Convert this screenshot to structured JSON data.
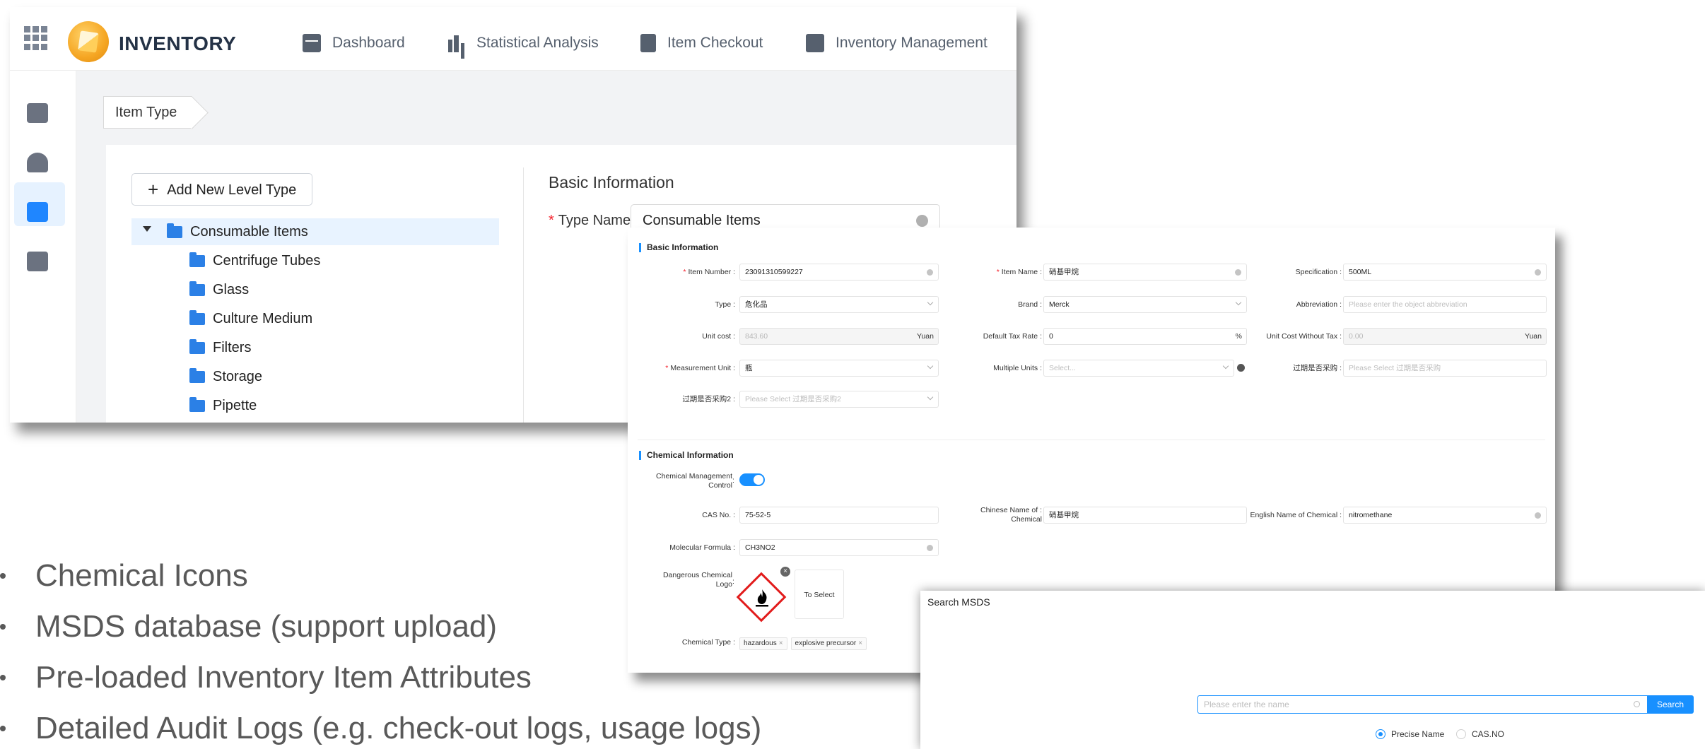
{
  "app": {
    "brand": "INVENTORY",
    "nav": [
      {
        "label": "Dashboard",
        "icon": "dashboard-icon"
      },
      {
        "label": "Statistical Analysis",
        "icon": "statistics-icon"
      },
      {
        "label": "Item Checkout",
        "icon": "checkout-icon"
      },
      {
        "label": "Inventory Management",
        "icon": "inventory-management-icon"
      }
    ],
    "sidebar_icons": [
      "items-icon",
      "star-badge-icon",
      "item-type-icon",
      "truck-settings-icon"
    ],
    "breadcrumb": "Item Type",
    "add_button": "Add New Level Type",
    "tree": {
      "root": "Consumable Items",
      "children": [
        "Centrifuge Tubes",
        "Glass",
        "Culture Medium",
        "Filters",
        "Storage",
        "Pipette"
      ]
    },
    "basic_info_title": "Basic Information",
    "type_name_label": "Type Name",
    "type_name_value": "Consumable Items"
  },
  "item_form": {
    "basic_title": "Basic Information",
    "item_number": {
      "label": "Item Number",
      "value": "23091310599227"
    },
    "item_name": {
      "label": "Item Name",
      "value": "硝基甲烷"
    },
    "specification": {
      "label": "Specification",
      "value": "500ML"
    },
    "type": {
      "label": "Type",
      "value": "危化品"
    },
    "brand": {
      "label": "Brand",
      "value": "Merck"
    },
    "abbreviation": {
      "label": "Abbreviation",
      "placeholder": "Please enter the object abbreviation"
    },
    "unit_cost": {
      "label": "Unit cost",
      "value": "843.60",
      "suffix": "Yuan"
    },
    "default_tax_rate": {
      "label": "Default Tax Rate",
      "value": "0",
      "suffix": "%"
    },
    "unit_cost_without_tax": {
      "label": "Unit Cost Without Tax",
      "value": "0.00",
      "suffix": "Yuan"
    },
    "measurement_unit": {
      "label": "Measurement Unit",
      "value": "瓶"
    },
    "multiple_units": {
      "label": "Multiple Units",
      "placeholder": "Select..."
    },
    "expired_purchase": {
      "label": "过期是否采购",
      "placeholder": "Please Select 过期是否采购"
    },
    "expired_purchase2": {
      "label": "过期是否采购2",
      "placeholder": "Please Select 过期是否采购2"
    },
    "chem_title": "Chemical Information",
    "chem_control": {
      "label_line1": "Chemical Management",
      "label_line2": "Control",
      "enabled": true
    },
    "cas_no": {
      "label": "CAS No.",
      "value": "75-52-5"
    },
    "chinese_name": {
      "label_line1": "Chinese Name of",
      "label_line2": "Chemical",
      "value": "硝基甲烷"
    },
    "english_name": {
      "label": "English Name of Chemical",
      "value": "nitromethane"
    },
    "molecular_formula": {
      "label": "Molecular Formula",
      "value": "CH3NO2"
    },
    "dangerous_logo": {
      "label_line1": "Dangerous Chemical",
      "label_line2": "Logo",
      "to_select": "To Select"
    },
    "chemical_type": {
      "label": "Chemical Type",
      "tags": [
        "hazardous",
        "explosive precursor"
      ]
    }
  },
  "msds": {
    "title": "Search MSDS",
    "placeholder": "Please enter the name",
    "button": "Search",
    "options": [
      "Precise Name",
      "CAS.NO"
    ],
    "selected": "Precise Name"
  },
  "features": [
    "Chemical Icons",
    "MSDS database (support upload)",
    "Pre-loaded Inventory Item Attributes",
    "Detailed Audit Logs (e.g. check-out logs, usage logs)"
  ],
  "colors": {
    "accent": "#1890ff",
    "required": "#f5222d",
    "folder": "#2b80e6",
    "hazard": "#e21b1b"
  }
}
